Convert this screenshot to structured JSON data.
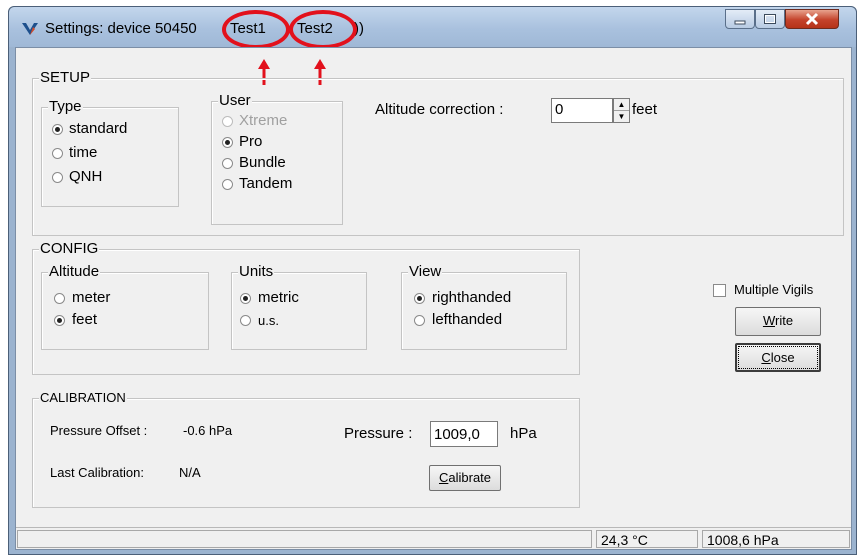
{
  "window": {
    "title": "Settings: device 50450",
    "title_tabs": [
      "Test1",
      "Test2"
    ],
    "title_suffix": "))",
    "highlight_color": "#e2111c",
    "buttons": [
      "minimize-icon",
      "maximize-icon",
      "close-icon"
    ]
  },
  "setup": {
    "label": "SETUP",
    "type": {
      "label": "Type",
      "options": [
        "standard",
        "time",
        "QNH"
      ],
      "selected": "standard"
    },
    "user": {
      "label": "User",
      "options": [
        "Xtreme",
        "Pro",
        "Bundle",
        "Tandem"
      ],
      "disabled": [
        "Xtreme"
      ],
      "selected": "Pro"
    },
    "altitude_correction": {
      "label": "Altitude correction :",
      "value": "0",
      "unit": "feet"
    }
  },
  "config": {
    "label": "CONFIG",
    "altitude": {
      "label": "Altitude",
      "options": [
        "meter",
        "feet"
      ],
      "selected": "feet"
    },
    "units": {
      "label": "Units",
      "options": [
        "metric",
        "u.s."
      ],
      "selected": "metric"
    },
    "view": {
      "label": "View",
      "options": [
        "righthanded",
        "lefthanded"
      ],
      "selected": "righthanded"
    }
  },
  "calibration": {
    "label": "CALIBRATION",
    "pressure_offset_label": "Pressure Offset :",
    "pressure_offset_value": "-0.6  hPa",
    "last_calibration_label": "Last Calibration:",
    "last_calibration_value": "N/A",
    "pressure_label": "Pressure :",
    "pressure_value": "1009,0",
    "pressure_unit": "hPa",
    "calibrate_button": "Calibrate"
  },
  "side": {
    "multiple_vigils_label": "Multiple Vigils",
    "multiple_vigils_checked": false,
    "write_button": "Write",
    "close_button": "Close"
  },
  "status": {
    "temperature": "24,3 °C",
    "pressure": "1008,6 hPa"
  }
}
